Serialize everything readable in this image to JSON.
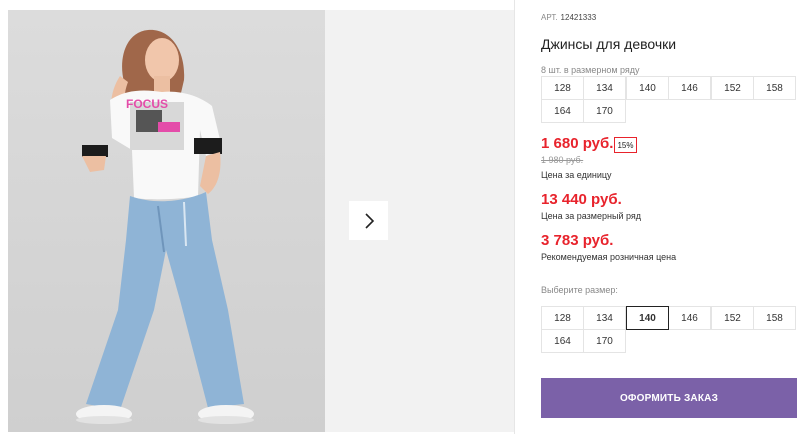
{
  "product": {
    "article_label": "АРТ.",
    "article_number": "12421333",
    "title": "Джинсы для девочки"
  },
  "gallery": {
    "next_icon": "chevron-right-icon"
  },
  "size_row": {
    "hint": "8 шт. в размерном ряду",
    "sizes": [
      "128",
      "134",
      "140",
      "146",
      "152",
      "158",
      "164",
      "170"
    ]
  },
  "prices": {
    "unit_price": "1 680 руб.",
    "discount": "15%",
    "old_price": "1 980 руб.",
    "unit_label": "Цена за единицу",
    "row_price": "13 440 руб.",
    "row_label": "Цена за размерный ряд",
    "rrp_price": "3 783 руб.",
    "rrp_label": "Рекомендуемая розничная цена"
  },
  "size_select": {
    "hint": "Выберите размер:",
    "sizes": [
      "128",
      "134",
      "140",
      "146",
      "152",
      "158",
      "164",
      "170"
    ],
    "selected": "140"
  },
  "order_button": "ОФОРМИТЬ ЗАКАЗ",
  "colors": {
    "price_red": "#e8232c",
    "order_button": "#7b61a8"
  }
}
